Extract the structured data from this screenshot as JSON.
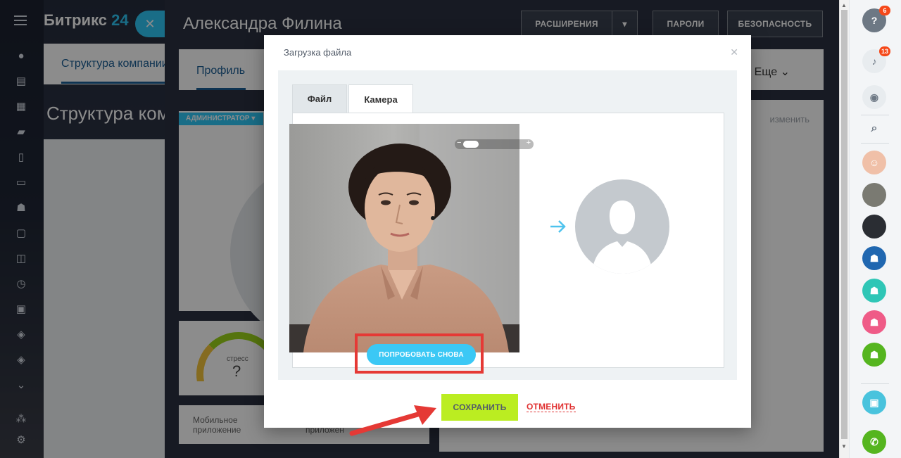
{
  "portal": {
    "brand_name": "Битрикс",
    "brand_number": "24",
    "background_tab": "Структура компании",
    "background_heading": "Структура компании"
  },
  "profile": {
    "user_name": "Александра Филина",
    "header_buttons": [
      "РАСШИРЕНИЯ",
      "ПАРОЛИ",
      "БЕЗОПАСНОСТЬ"
    ],
    "tab_profile": "Профиль",
    "tab_more": "Еще",
    "role_badge": "АДМИНИСТРАТОР",
    "stress_label": "стресс",
    "stress_value": "?",
    "mobile_line1": "Мобильное",
    "mobile_line2": "приложение",
    "mobile_partial": "приложен",
    "edit_link": "изменить"
  },
  "right_rail": {
    "help_badge": "6",
    "notifications_badge": "13",
    "icons": [
      "help-icon",
      "bell-icon",
      "chat-icon",
      "search-icon",
      "avatar",
      "avatar",
      "avatar",
      "group-chat-icon",
      "users-icon",
      "users-icon",
      "users-icon",
      "phone-call-icon"
    ]
  },
  "dialog": {
    "title": "Загрузка файла",
    "tabs": [
      {
        "label": "Файл",
        "active": false
      },
      {
        "label": "Камера",
        "active": true
      }
    ],
    "retry_button": "ПОПРОБОВАТЬ СНОВА",
    "save_button": "СОХРАНИТЬ",
    "cancel_link": "ОТМЕНИТЬ"
  },
  "colors": {
    "accent_blue": "#2fc6f6",
    "save_green": "#bbed21",
    "cancel_red": "#e03131",
    "annotation_red": "#e53935"
  }
}
